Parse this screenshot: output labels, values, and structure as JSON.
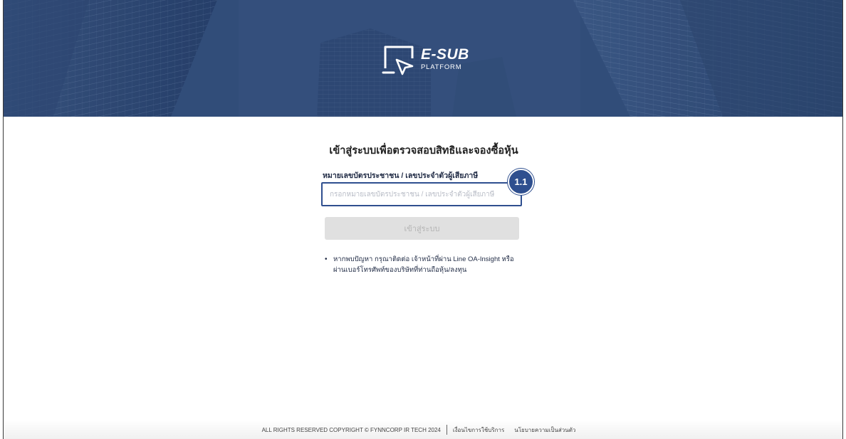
{
  "brand": {
    "title": "E-SUB",
    "subtitle": "PLATFORM"
  },
  "login": {
    "heading": "เข้าสู่ระบบเพื่อตรวจสอบสิทธิและจองซื้อหุ้น",
    "id_label": "หมายเลขบัตรประชาชน / เลขประจำตัวผู้เสียภาษี",
    "id_placeholder": "กรอกหมายเลขบัตรประชาชน / เลขประจำตัวผู้เสียภาษี",
    "id_value": "",
    "step_badge": "1.1",
    "submit_label": "เข้าสู่ระบบ",
    "note_line1": "หากพบปัญหา กรุณาติดต่อ เจ้าหน้าที่ผ่าน Line OA-Insight หรือ",
    "note_line2": "ผ่านเบอร์โทรศัพท์ของบริษัทที่ท่านถือหุ้น/ลงทุน"
  },
  "footer": {
    "copyright": "ALL RIGHTS RESERVED COPYRIGHT © FYNNCORP IR TECH 2024",
    "terms": "เงื่อนไขการใช้บริการ",
    "privacy": "นโยบายความเป็นส่วนตัว"
  },
  "colors": {
    "hero": "#33507c",
    "accent": "#2f4f8f",
    "button_disabled": "#e0e0e0"
  },
  "icons": {
    "logo": "monitor-cursor-icon",
    "bullet": "bullet-dot-icon"
  }
}
